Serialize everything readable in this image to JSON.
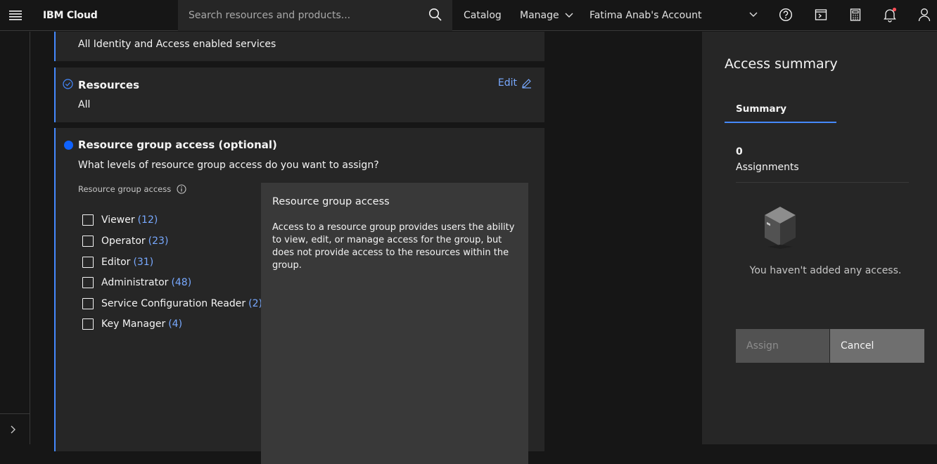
{
  "header": {
    "brand": "IBM Cloud",
    "search_placeholder": "Search resources and products...",
    "nav": {
      "catalog": "Catalog",
      "manage": "Manage",
      "account": "Fatima Anab's Account"
    },
    "icons": [
      "menu-icon",
      "search-icon",
      "chevron-down-icon",
      "help-icon",
      "terminal-icon",
      "calculator-icon",
      "notification-icon",
      "user-icon"
    ],
    "notification_color": "#fa4d56"
  },
  "cards": {
    "services": {
      "value": "All Identity and Access enabled services"
    },
    "resources": {
      "title": "Resources",
      "value": "All",
      "edit": "Edit"
    },
    "resource_group": {
      "title": "Resource group access (optional)",
      "question": "What levels of resource group access do you want to assign?",
      "field_label": "Resource group access",
      "roles": [
        {
          "label": "Viewer",
          "count": "(12)"
        },
        {
          "label": "Operator",
          "count": "(23)"
        },
        {
          "label": "Editor",
          "count": "(31)"
        },
        {
          "label": "Administrator",
          "count": "(48)"
        },
        {
          "label": "Service Configuration Reader",
          "count": "(2)"
        },
        {
          "label": "Key Manager",
          "count": "(4)"
        }
      ],
      "tooltip": {
        "title": "Resource group access",
        "body": "Access to a resource group provides users the ability to view, edit, or manage access for the group, but does not provide access to the resources within the group."
      }
    }
  },
  "summary": {
    "title": "Access summary",
    "tab": "Summary",
    "count": "0",
    "count_label": "Assignments",
    "empty": "You haven't added any access.",
    "assign": "Assign",
    "cancel": "Cancel"
  },
  "colors": {
    "accent": "#4589ff",
    "link": "#78a9ff",
    "step_dot": "#0f62fe"
  }
}
